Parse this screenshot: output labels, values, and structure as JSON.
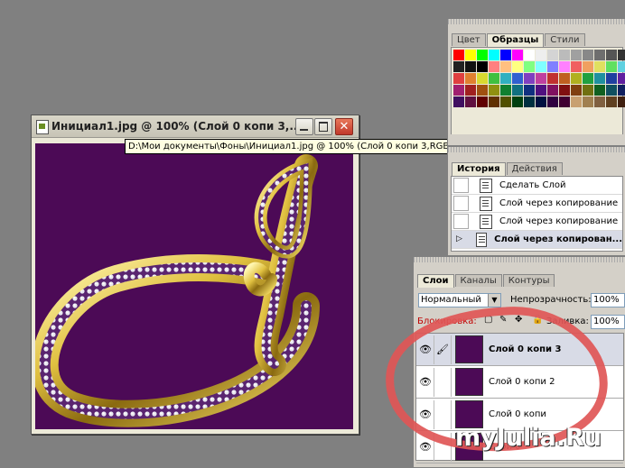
{
  "document": {
    "title": "Инициал1.jpg @ 100% (Слой 0 копи 3,...",
    "tooltip": "D:\\Мои документы\\Фоны\\Инициал1.jpg @ 100% (Слой 0 копи 3,RGB/8)",
    "close_label": "✕"
  },
  "swatches_panel": {
    "tabs": [
      "Цвет",
      "Образцы",
      "Стили"
    ],
    "active_tab": 1,
    "colors": [
      "#ff0000",
      "#ffff00",
      "#00ff00",
      "#00ffff",
      "#0000ff",
      "#ff00ff",
      "#ffffff",
      "#eeeeee",
      "#d4d4d4",
      "#bbbbbb",
      "#a0a0a0",
      "#888888",
      "#6e6e6e",
      "#555555",
      "#333333",
      "#222222",
      "#111111",
      "#000000",
      "#ff8080",
      "#ffc080",
      "#ffff80",
      "#80ff80",
      "#80ffff",
      "#8080ff",
      "#ff80ff",
      "#f06060",
      "#f0a060",
      "#e0e060",
      "#60e060",
      "#60d0e0",
      "#e04040",
      "#e08030",
      "#d8d830",
      "#40c040",
      "#30b0c0",
      "#3060d0",
      "#8040c0",
      "#c040a0",
      "#c03030",
      "#c06020",
      "#b0b020",
      "#20a040",
      "#2090a0",
      "#2040a0",
      "#6020a0",
      "#a02070",
      "#a02020",
      "#a05010",
      "#909010",
      "#108030",
      "#107080",
      "#103080",
      "#501080",
      "#801060",
      "#801010",
      "#804010",
      "#707010",
      "#106020",
      "#105060",
      "#102060",
      "#401060",
      "#601040",
      "#600000",
      "#603000",
      "#505000",
      "#004010",
      "#003040",
      "#001040",
      "#300040",
      "#400030",
      "#c8a070",
      "#a08050",
      "#806040",
      "#604020",
      "#402010"
    ]
  },
  "history_panel": {
    "tabs": [
      "История",
      "Действия"
    ],
    "active_tab": 0,
    "items": [
      "Сделать Слой",
      "Слой через копирование",
      "Слой через копирование",
      "Слой через копирован..."
    ],
    "selected_index": 3
  },
  "layers_panel": {
    "tabs": [
      "Слои",
      "Каналы",
      "Контуры"
    ],
    "active_tab": 0,
    "blend_mode": "Нормальный",
    "opacity_label": "Непрозрачность:",
    "opacity_value": "100%",
    "lock_label": "Блокировка:",
    "fill_label": "Заливка:",
    "fill_value": "100%",
    "layers": [
      {
        "name": "Слой 0 копи 3",
        "selected": true
      },
      {
        "name": "Слой 0 копи 2",
        "selected": false
      },
      {
        "name": "Слой 0 копи",
        "selected": false
      },
      {
        "name": "Слой 0",
        "selected": false
      }
    ]
  },
  "watermark": "myJulia.Ru",
  "colors": {
    "canvas_bg": "#4c0a56",
    "gold": "#d4b43a",
    "annotation_red": "#e05656"
  }
}
